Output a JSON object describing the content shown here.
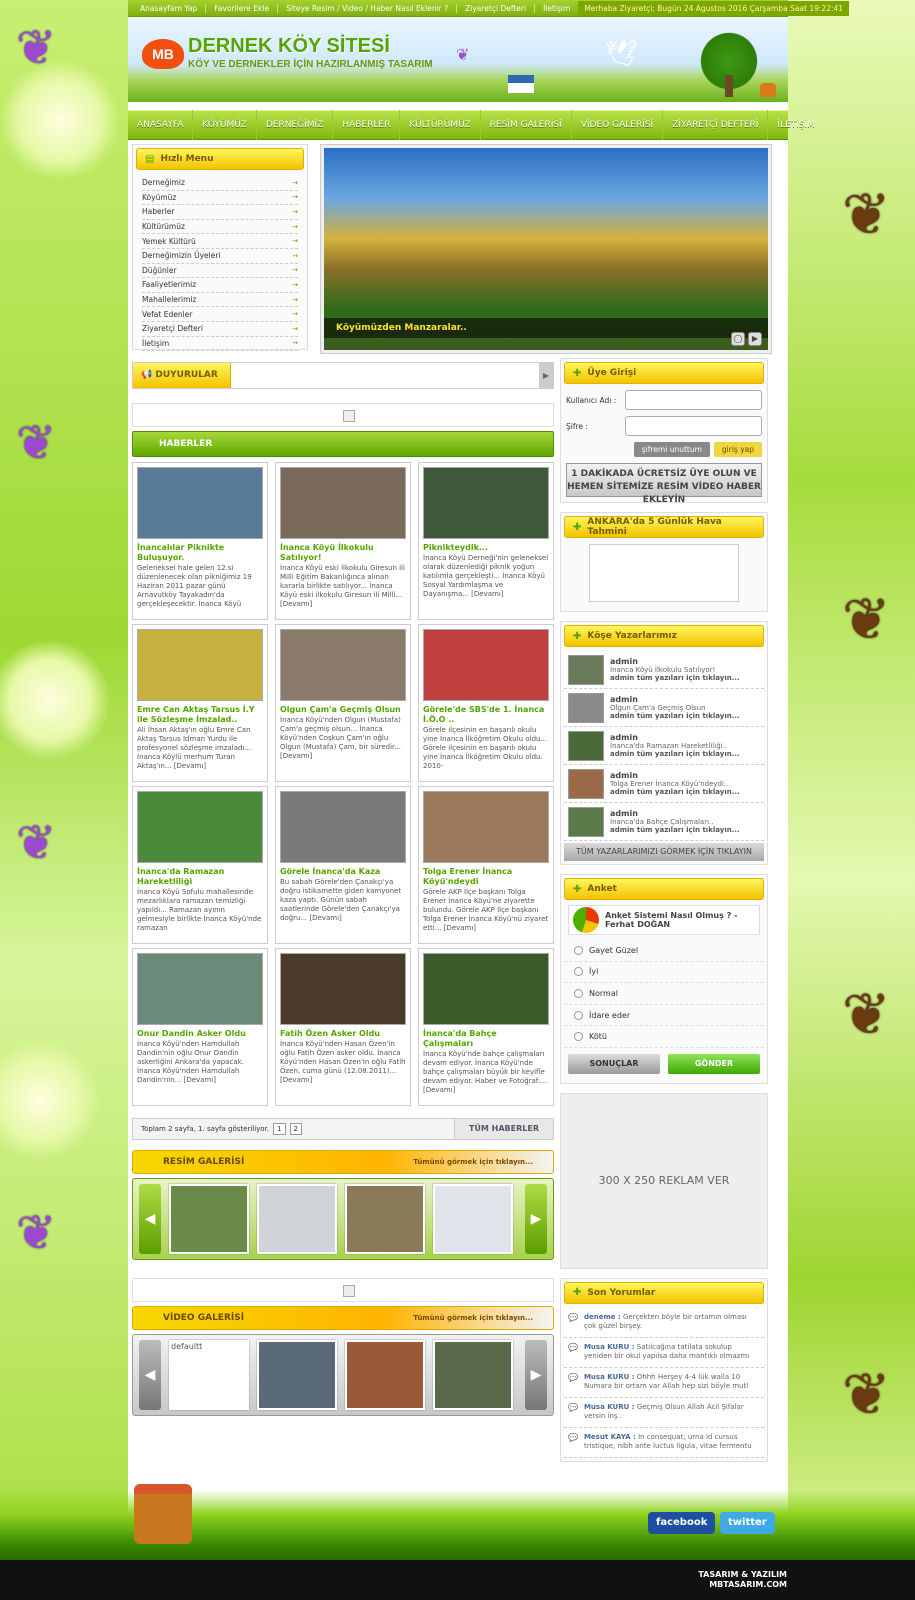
{
  "topbar": {
    "links": [
      "Anasayfam Yap",
      "Favorilere Ekle",
      "Siteye Resim / Video / Haber Nasıl Eklenir ?",
      "Ziyaretçi Defteri",
      "İletişim"
    ],
    "greeting": "Merhaba Ziyaretçi; Bugün 24 Agustos 2016 Çarşamba Saat 19:22:41"
  },
  "header": {
    "logo_text": "MB",
    "title": "DERNEK KÖY SİTESİ",
    "subtitle": "KÖY VE DERNEKLER İÇİN HAZIRLANMIŞ TASARIM"
  },
  "nav": [
    "ANASAYFA",
    "KÖYÜMÜZ",
    "DERNEĞİMİZ",
    "HABERLER",
    "KÜLTÜRÜMÜZ",
    "RESİM GALERİSİ",
    "VİDEO GALERİSİ",
    "ZİYARETÇİ DEFTERİ",
    "İLETİŞİM"
  ],
  "quick_menu": {
    "title": "Hızlı Menu",
    "items": [
      "Derneğimiz",
      "Köyümüz",
      "Haberler",
      "Kültürümüz",
      "Yemek Kültürü",
      "Derneğimizin Üyeleri",
      "Düğünler",
      "Faaliyetlerimiz",
      "Mahallelerimiz",
      "Vefat Edenler",
      "Ziyaretçi Defteri",
      "İletişim"
    ]
  },
  "slider": {
    "caption": "Köyümüzden Manzaralar.."
  },
  "announcements": {
    "label": "DUYURULAR"
  },
  "news": {
    "title": "HABERLER",
    "items": [
      {
        "title": "İnancalılar Piknikte Buluşuyor.",
        "desc": "Geleneksel hale gelen 12.si düzenlenecek olan pikniğimiz 19 Haziran 2011 pazar günü Arnavutköy Tayakadın'da gerçekleşecektir. İnanca Köyü",
        "color": "#5a7a9a"
      },
      {
        "title": "İnanca Köyü İlkokulu Satılıyor!",
        "desc": "İnanca Köyü eski ilkokulu Giresun ili Milli Eğitim Bakanlığınca alınan kararla birlikte satılıyor... İnanca Köyü eski ilkokulu Giresun ili Milli... [Devamı]",
        "color": "#7a6a5a"
      },
      {
        "title": "Piknikteydik...",
        "desc": "İnanca Köyü Derneği'nin geleneksel olarak düzenlediği piknik yoğun katılımla gerçekleşti... İnanca Köyü Sosyal Yardımlaşma ve Dayanışma... [Devamı]",
        "color": "#3e5a3a"
      },
      {
        "title": "Emre Can Aktaş Tarsus İ.Y ile Sözleşme İmzalad..",
        "desc": "Ali İhsan Aktaş'ın oğlu Emre Can Aktaş Tarsus İdman Yurdu ile profesyonel sözleşme imzaladı... İnanca Köylü merhum Turan Aktaş'ın... [Devamı]",
        "color": "#c8b040"
      },
      {
        "title": "Olgun Çam'a Geçmiş Olsun",
        "desc": "İnanca Köyü'nden Olgun (Mustafa) Çam'a geçmiş olsun... İnanca Köyü'nden Coşkun Çam'ın oğlu Olgun (Mustafa) Çam, bir süredir... [Devamı]",
        "color": "#8a7a6a"
      },
      {
        "title": "Görele'de SBS'de 1. İnanca İ.Ö.O ..",
        "desc": "Görele ilçesinin en başarılı okulu yine İnanca İlköğretim Okulu oldu... Görele ilçesinin en başarılı okulu yine İnanca İlköğretim Okulu oldu. 2010-",
        "color": "#c04040"
      },
      {
        "title": "İnanca'da Ramazan Hareketliliği",
        "desc": "İnanca Köyü Sofulu mahallesinde mezarlıklara ramazan temizliği yapıldı... Ramazan ayının gelmesiyle birlikte İnanca Köyü'nde ramazan",
        "color": "#4a8a3a"
      },
      {
        "title": "Görele İnanca'da Kaza",
        "desc": "Bu sabah Görele'den Çanakçı'ya doğru istikamette giden kamyonet kaza yaptı. Günün sabah saatlerinde Görele'den Çanakçı'ya doğru... [Devamı]",
        "color": "#7a7a7a"
      },
      {
        "title": "Tolga Erener İnanca Köyü'ndeydi",
        "desc": "Görele AKP İlçe başkanı Tolga Erener İnanca Köyü'ne ziyarette bulundu. Görele AKP İlçe başkanı Tolga Erener İnanca Köyü'nü ziyaret etti... [Devamı]",
        "color": "#9a7a5a"
      },
      {
        "title": "Onur Dandin Asker Oldu",
        "desc": "İnanca Köyü'nden Hamdullah Dandin'nin oğlu Onur Dandin askerliğini Ankara'da yapacak. İnanca Köyü'nden Hamdullah Dandin'nin... [Devamı]",
        "color": "#6a8a7a"
      },
      {
        "title": "Fatih Özen Asker Oldu",
        "desc": "İnanca Köyü'nden Hasan Özen'in oğlu Fatih Özen asker oldu. İnanca Köyü'nden Hasan Özen'in oğlu Fatih Özen, cuma günü (12.08.2011)... [Devamı]",
        "color": "#4a3a2a"
      },
      {
        "title": "İnanca'da Bahçe Çalışmaları",
        "desc": "İnanca Köyü'nde bahçe çalışmaları devam ediyor. İnanca Köyü'nde bahçe çalışmaları büyük bir keyifle devam ediyor. Haber ve Fotoğraf:... [Devamı]",
        "color": "#3a5a2a"
      }
    ],
    "pager_text": "Toplam 2 sayfa, 1. sayfa gösteriliyor.",
    "pages": [
      "1",
      "2"
    ],
    "all_label": "TÜM HABERLER"
  },
  "gallery": {
    "title": "RESİM GALERİSİ",
    "more": "Tümünü görmek için tıklayın...",
    "thumb_colors": [
      "#6a8a4a",
      "#cfd4d8",
      "#8a7a5a",
      "#dfe4ea"
    ]
  },
  "video": {
    "title": "VİDEO GALERİSİ",
    "more": "Tümünü görmek için tıklayın...",
    "first_alt": "defaultt",
    "thumb_colors": [
      "#fff",
      "#5a6a7a",
      "#9a5a3a",
      "#5a6a4a"
    ]
  },
  "login": {
    "title": "Üye Girişi",
    "username_label": "Kullanıcı Adı",
    "password_label": "Şifre",
    "sep": ":",
    "forgot": "şifremi unuttum",
    "login": "giriş yap",
    "register": "1 DAKİKADA ÜCRETSİZ ÜYE OLUN VE HEMEN SİTEMİZE RESİM VİDEO HABER EKLEYİN"
  },
  "weather": {
    "title": "ANKARA'da 5 Günlük Hava Tahmini"
  },
  "authors": {
    "title": "Köşe Yazarlarımız",
    "items": [
      {
        "name": "admin",
        "text": "İnanca Köyü İlkokulu Satılıyor!",
        "link": "admin tüm yazıları için tıklayın..."
      },
      {
        "name": "admin",
        "text": "Olgun Çam'a Geçmiş Olsun",
        "link": "admin tüm yazıları için tıklayın..."
      },
      {
        "name": "admin",
        "text": "İnanca'da Ramazan Hareketliliği..",
        "link": "admin tüm yazıları için tıklayın..."
      },
      {
        "name": "admin",
        "text": "Tolga Erener İnanca Köyü'ndeydi..",
        "link": "admin tüm yazıları için tıklayın..."
      },
      {
        "name": "admin",
        "text": "İnanca'da Bahçe Çalışmaları..",
        "link": "admin tüm yazıları için tıklayın..."
      }
    ],
    "all": "TÜM YAZARLARIMIZI GÖRMEK İÇİN TIKLAYIN"
  },
  "poll": {
    "title": "Anket",
    "question": "Anket Sistemi Nasıl Olmuş ? - Ferhat DOĞAN",
    "options": [
      "Gayet Güzel",
      "İyi",
      "Normal",
      "İdare eder",
      "Kötü"
    ],
    "results": "SONUÇLAR",
    "vote": "GÖNDER"
  },
  "ad": {
    "text": "300 X 250 REKLAM VER"
  },
  "comments": {
    "title": "Son Yorumlar",
    "items": [
      {
        "name": "deneme :",
        "text": "Gerçekten böyle bir ortamın olması çok güzel birşey."
      },
      {
        "name": "Musa KURU :",
        "text": "Satılcağına tatilata sokulup yeniden bir okul yapılsa daha mantıklı olmazmı"
      },
      {
        "name": "Musa KURU :",
        "text": "Ohhh Herşey 4-4 lük walla 10 Numara bir ortam var Allah hep sizi böyle mutl"
      },
      {
        "name": "Musa KURU :",
        "text": "Geçmiş Olsun Allah Acil Şifalar versin inş.."
      },
      {
        "name": "Mesut KAYA :",
        "text": "In consequat; urna id cursus tristique, nibh ante luctus ligula, vitae fermentu"
      }
    ]
  },
  "footer": {
    "facebook": "facebook",
    "twitter": "twitter",
    "credit1": "TASARIM & YAZILIM",
    "credit2": "MBTASARIM.COM"
  }
}
